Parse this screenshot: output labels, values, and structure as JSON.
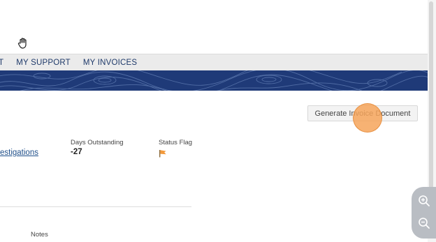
{
  "nav": {
    "items": [
      "T",
      "MY SUPPORT",
      "MY INVOICES"
    ]
  },
  "toolbar": {
    "generate_label": "Generate Invoice Document"
  },
  "invoice": {
    "link_partial": "estigations",
    "days_outstanding_label": "Days Outstanding",
    "days_outstanding_value": "-27",
    "status_flag_label": "Status Flag",
    "notes_label": "Notes"
  },
  "colors": {
    "nav_text": "#1f3a6a",
    "banner": "#1f3a78",
    "flag": "#f39a3c",
    "click_marker": "#f6a55a"
  },
  "icons": [
    "hand-cursor-icon",
    "flag-icon",
    "zoom-in-icon",
    "zoom-out-icon"
  ]
}
